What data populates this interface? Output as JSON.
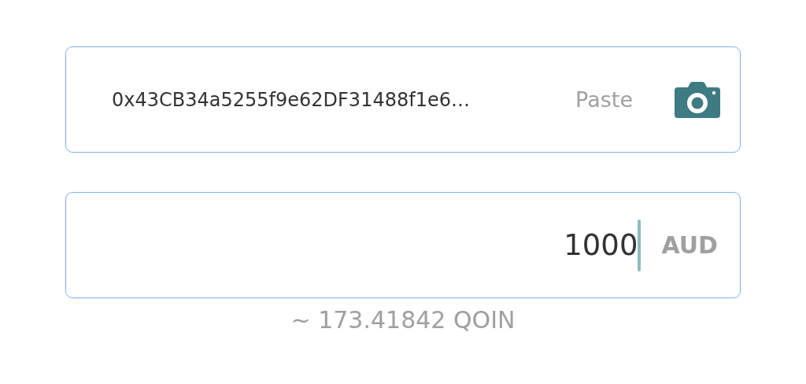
{
  "address_field": {
    "value": "0x43CB34a5255f9e62DF31488f1e6…",
    "paste_label": "Paste"
  },
  "amount_field": {
    "value": "1000",
    "currency": "AUD",
    "focused": true
  },
  "conversion": "~ 173.41842 QOIN"
}
